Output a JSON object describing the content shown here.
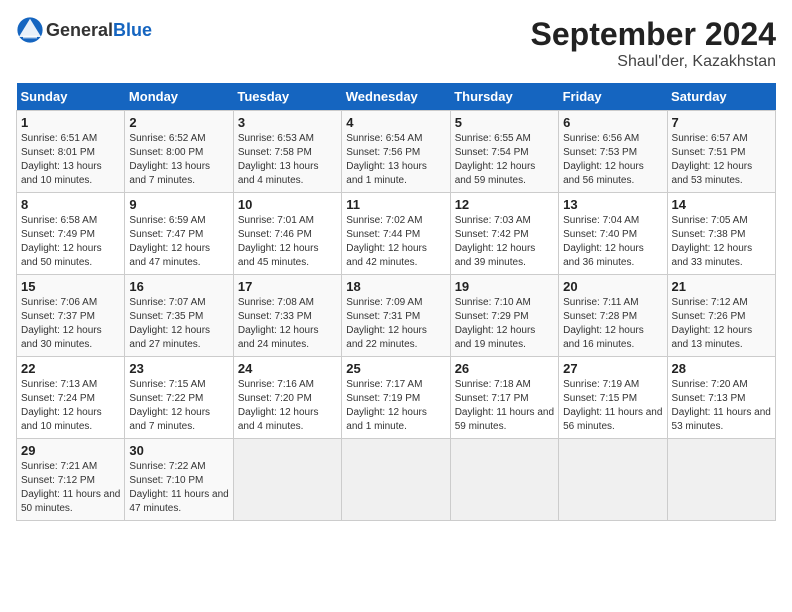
{
  "header": {
    "logo_general": "General",
    "logo_blue": "Blue",
    "title": "September 2024",
    "subtitle": "Shaul'der, Kazakhstan"
  },
  "calendar": {
    "days_of_week": [
      "Sunday",
      "Monday",
      "Tuesday",
      "Wednesday",
      "Thursday",
      "Friday",
      "Saturday"
    ],
    "weeks": [
      [
        {
          "day": "1",
          "info": "Sunrise: 6:51 AM\nSunset: 8:01 PM\nDaylight: 13 hours and 10 minutes."
        },
        {
          "day": "2",
          "info": "Sunrise: 6:52 AM\nSunset: 8:00 PM\nDaylight: 13 hours and 7 minutes."
        },
        {
          "day": "3",
          "info": "Sunrise: 6:53 AM\nSunset: 7:58 PM\nDaylight: 13 hours and 4 minutes."
        },
        {
          "day": "4",
          "info": "Sunrise: 6:54 AM\nSunset: 7:56 PM\nDaylight: 13 hours and 1 minute."
        },
        {
          "day": "5",
          "info": "Sunrise: 6:55 AM\nSunset: 7:54 PM\nDaylight: 12 hours and 59 minutes."
        },
        {
          "day": "6",
          "info": "Sunrise: 6:56 AM\nSunset: 7:53 PM\nDaylight: 12 hours and 56 minutes."
        },
        {
          "day": "7",
          "info": "Sunrise: 6:57 AM\nSunset: 7:51 PM\nDaylight: 12 hours and 53 minutes."
        }
      ],
      [
        {
          "day": "8",
          "info": "Sunrise: 6:58 AM\nSunset: 7:49 PM\nDaylight: 12 hours and 50 minutes."
        },
        {
          "day": "9",
          "info": "Sunrise: 6:59 AM\nSunset: 7:47 PM\nDaylight: 12 hours and 47 minutes."
        },
        {
          "day": "10",
          "info": "Sunrise: 7:01 AM\nSunset: 7:46 PM\nDaylight: 12 hours and 45 minutes."
        },
        {
          "day": "11",
          "info": "Sunrise: 7:02 AM\nSunset: 7:44 PM\nDaylight: 12 hours and 42 minutes."
        },
        {
          "day": "12",
          "info": "Sunrise: 7:03 AM\nSunset: 7:42 PM\nDaylight: 12 hours and 39 minutes."
        },
        {
          "day": "13",
          "info": "Sunrise: 7:04 AM\nSunset: 7:40 PM\nDaylight: 12 hours and 36 minutes."
        },
        {
          "day": "14",
          "info": "Sunrise: 7:05 AM\nSunset: 7:38 PM\nDaylight: 12 hours and 33 minutes."
        }
      ],
      [
        {
          "day": "15",
          "info": "Sunrise: 7:06 AM\nSunset: 7:37 PM\nDaylight: 12 hours and 30 minutes."
        },
        {
          "day": "16",
          "info": "Sunrise: 7:07 AM\nSunset: 7:35 PM\nDaylight: 12 hours and 27 minutes."
        },
        {
          "day": "17",
          "info": "Sunrise: 7:08 AM\nSunset: 7:33 PM\nDaylight: 12 hours and 24 minutes."
        },
        {
          "day": "18",
          "info": "Sunrise: 7:09 AM\nSunset: 7:31 PM\nDaylight: 12 hours and 22 minutes."
        },
        {
          "day": "19",
          "info": "Sunrise: 7:10 AM\nSunset: 7:29 PM\nDaylight: 12 hours and 19 minutes."
        },
        {
          "day": "20",
          "info": "Sunrise: 7:11 AM\nSunset: 7:28 PM\nDaylight: 12 hours and 16 minutes."
        },
        {
          "day": "21",
          "info": "Sunrise: 7:12 AM\nSunset: 7:26 PM\nDaylight: 12 hours and 13 minutes."
        }
      ],
      [
        {
          "day": "22",
          "info": "Sunrise: 7:13 AM\nSunset: 7:24 PM\nDaylight: 12 hours and 10 minutes."
        },
        {
          "day": "23",
          "info": "Sunrise: 7:15 AM\nSunset: 7:22 PM\nDaylight: 12 hours and 7 minutes."
        },
        {
          "day": "24",
          "info": "Sunrise: 7:16 AM\nSunset: 7:20 PM\nDaylight: 12 hours and 4 minutes."
        },
        {
          "day": "25",
          "info": "Sunrise: 7:17 AM\nSunset: 7:19 PM\nDaylight: 12 hours and 1 minute."
        },
        {
          "day": "26",
          "info": "Sunrise: 7:18 AM\nSunset: 7:17 PM\nDaylight: 11 hours and 59 minutes."
        },
        {
          "day": "27",
          "info": "Sunrise: 7:19 AM\nSunset: 7:15 PM\nDaylight: 11 hours and 56 minutes."
        },
        {
          "day": "28",
          "info": "Sunrise: 7:20 AM\nSunset: 7:13 PM\nDaylight: 11 hours and 53 minutes."
        }
      ],
      [
        {
          "day": "29",
          "info": "Sunrise: 7:21 AM\nSunset: 7:12 PM\nDaylight: 11 hours and 50 minutes."
        },
        {
          "day": "30",
          "info": "Sunrise: 7:22 AM\nSunset: 7:10 PM\nDaylight: 11 hours and 47 minutes."
        },
        {
          "day": "",
          "info": ""
        },
        {
          "day": "",
          "info": ""
        },
        {
          "day": "",
          "info": ""
        },
        {
          "day": "",
          "info": ""
        },
        {
          "day": "",
          "info": ""
        }
      ]
    ]
  }
}
